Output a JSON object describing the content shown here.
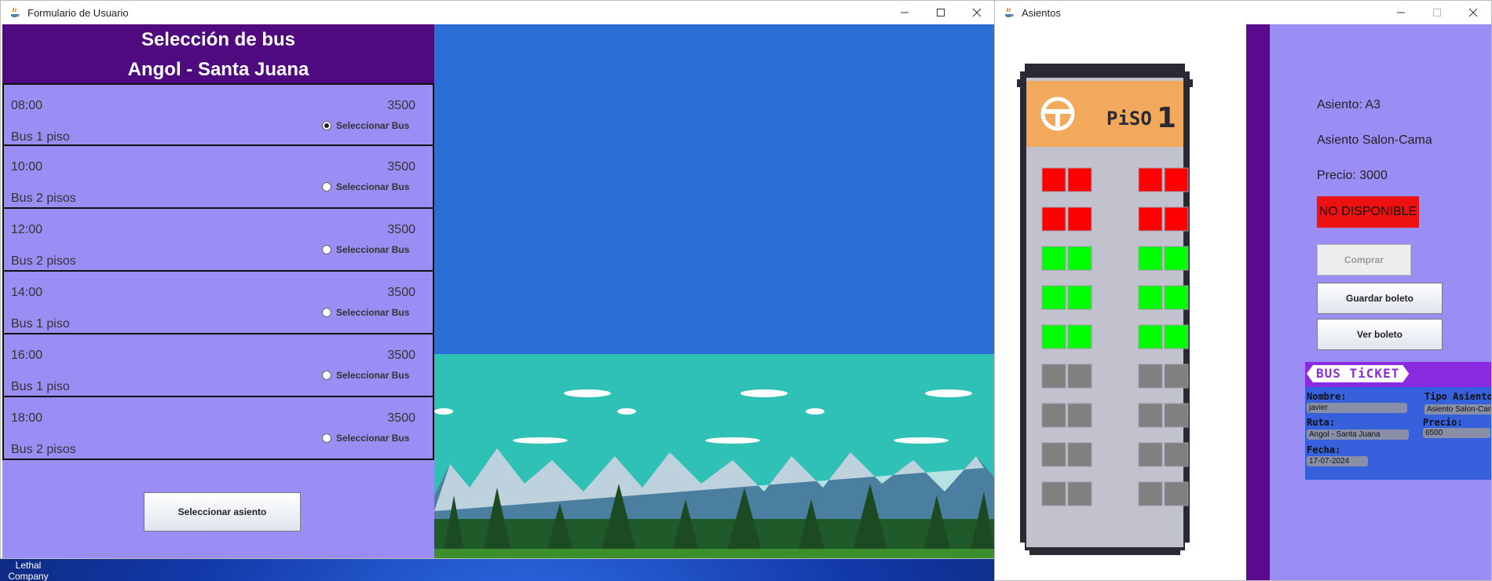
{
  "desktop": {
    "icon_label": "Lethal Company"
  },
  "left_window": {
    "title": "Formulario de Usuario",
    "header": {
      "line1": "Selección de bus",
      "line2": "Angol - Santa Juana"
    },
    "buses": [
      {
        "time": "08:00",
        "price": "3500",
        "type": "Bus 1 piso",
        "select_label": "Seleccionar Bus",
        "selected": true
      },
      {
        "time": "10:00",
        "price": "3500",
        "type": "Bus 2 pisos",
        "select_label": "Seleccionar Bus",
        "selected": false
      },
      {
        "time": "12:00",
        "price": "3500",
        "type": "Bus 2 pisos",
        "select_label": "Seleccionar Bus",
        "selected": false
      },
      {
        "time": "14:00",
        "price": "3500",
        "type": "Bus 1 piso",
        "select_label": "Seleccionar Bus",
        "selected": false
      },
      {
        "time": "16:00",
        "price": "3500",
        "type": "Bus 1 piso",
        "select_label": "Seleccionar Bus",
        "selected": false
      },
      {
        "time": "18:00",
        "price": "3500",
        "type": "Bus 2 pisos",
        "select_label": "Seleccionar Bus",
        "selected": false
      }
    ],
    "select_seat_button": "Seleccionar asiento"
  },
  "right_window": {
    "title": "Asientos",
    "floor_label": "PiSO",
    "floor_number": "1",
    "seat_rows": [
      [
        "taken",
        "taken",
        "taken",
        "taken"
      ],
      [
        "taken",
        "taken",
        "taken",
        "taken"
      ],
      [
        "free",
        "free",
        "free",
        "free"
      ],
      [
        "free",
        "free",
        "free",
        "free"
      ],
      [
        "free",
        "free",
        "free",
        "free"
      ],
      [
        "none",
        "none",
        "none",
        "none"
      ],
      [
        "none",
        "none",
        "none",
        "none"
      ],
      [
        "none",
        "none",
        "none",
        "none"
      ],
      [
        "none",
        "none",
        "none",
        "none"
      ]
    ],
    "seat_colors": {
      "taken": "#ff0000",
      "free": "#00ff00",
      "none": "#808080"
    },
    "info": {
      "seat": "Asiento: A3",
      "seat_type": "Asiento Salon-Cama",
      "price": "Precio: 3000",
      "status": "NO DISPONIBLE"
    },
    "buttons": {
      "buy": "Comprar",
      "save": "Guardar boleto",
      "view": "Ver boleto"
    },
    "ticket": {
      "banner": "BUS TiCKET",
      "name_label": "Nombre:",
      "name_value": "javier",
      "seat_type_label": "Tipo Asiento:",
      "seat_type_value": "Asiento Salon-Cama",
      "route_label": "Ruta:",
      "route_value": "Angol - Santa Juana",
      "price_label": "Precio:",
      "price_value": "6500",
      "date_label": "Fecha:",
      "date_value": "17-07-2024"
    }
  }
}
